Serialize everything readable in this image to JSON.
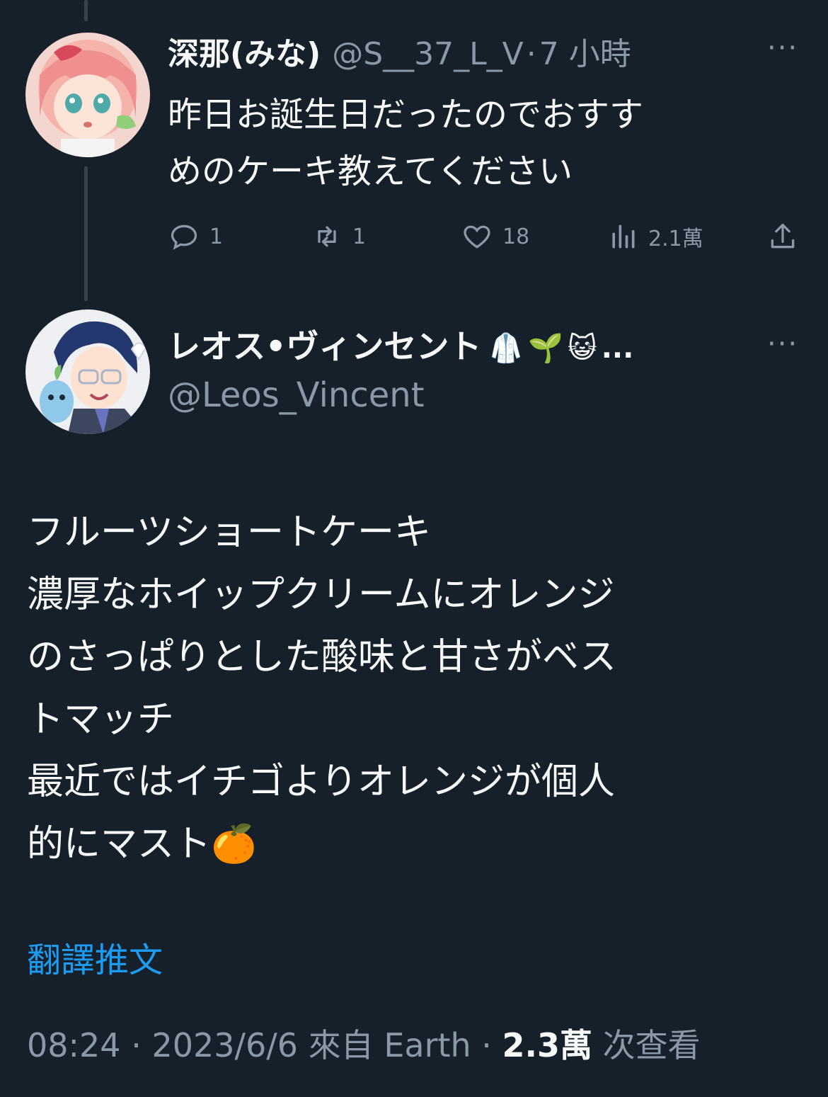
{
  "tweet1": {
    "display_name": "深那(みな)",
    "handle": "@S__37_L_V",
    "separator": "·",
    "time": "7 小時",
    "text": "昨日お誕生日だったのでおすす\nめのケーキ教えてください",
    "actions": {
      "reply_count": "1",
      "retweet_count": "1",
      "like_count": "18",
      "view_count": "2.1萬"
    }
  },
  "tweet2": {
    "display_name": "レオス•ヴィンセント",
    "name_emojis": "🥼🌱😺",
    "name_ellipsis": "...",
    "handle": "@Leos_Vincent",
    "text": "フルーツショートケーキ\n濃厚なホイップクリームにオレンジ\nのさっぱりとした酸味と甘さがベス\nトマッチ\n最近ではイチゴよりオレンジが個人\n的にマスト🍊",
    "translate_link": "翻譯推文",
    "meta": {
      "time": "08:24",
      "separator": "·",
      "date": "2023/6/6",
      "source_prefix": "來自",
      "source": "Earth",
      "separator2": "·",
      "views": "2.3萬",
      "views_suffix": "次查看"
    }
  },
  "colors": {
    "background": "#15202b",
    "text": "#f7f9f9",
    "muted": "#8b98a5",
    "link": "#1d9bf0",
    "thread_line": "#38444d"
  }
}
